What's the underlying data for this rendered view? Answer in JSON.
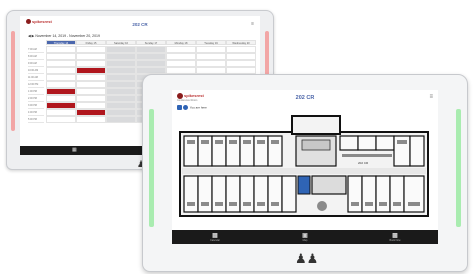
{
  "back_device": {
    "title": "202 CR",
    "logo_text": "spikesrest",
    "menu_icon": "hamburger-icon",
    "date_range": "November 14, 2019 - November 20, 2019",
    "days": [
      "Thursday 14",
      "Friday 15",
      "Saturday 16",
      "Sunday 17",
      "Monday 18",
      "Tuesday 19",
      "Wednesday 20"
    ],
    "times": [
      "7:00 AM",
      "8:00 AM",
      "9:00 AM",
      "10:00 AM",
      "11:00 AM",
      "12:00 PM",
      "1:00 PM",
      "2:00 PM",
      "3:00 PM",
      "4:00 PM",
      "5:00 PM"
    ],
    "bottom_nav_icon": "calendar-icon",
    "colors": {
      "booked": "#b0161d",
      "active_day": "#4b67ad",
      "led": "#f2a6a6"
    }
  },
  "front_device": {
    "title": "202 CR",
    "logo_text": "spikesrest",
    "logo_sub": "Conference Room",
    "menu_icon": "hamburger-icon",
    "you_are_here": "You are here",
    "room_label": "202 CR",
    "bottom_nav": [
      {
        "icon": "calendar-icon",
        "label": "Calendar"
      },
      {
        "icon": "map-icon",
        "label": "Map"
      },
      {
        "icon": "book-icon",
        "label": "Book Now"
      }
    ],
    "colors": {
      "led": "#a9ecb0",
      "title": "#4a64a8",
      "highlight": "#2f64b5"
    }
  }
}
